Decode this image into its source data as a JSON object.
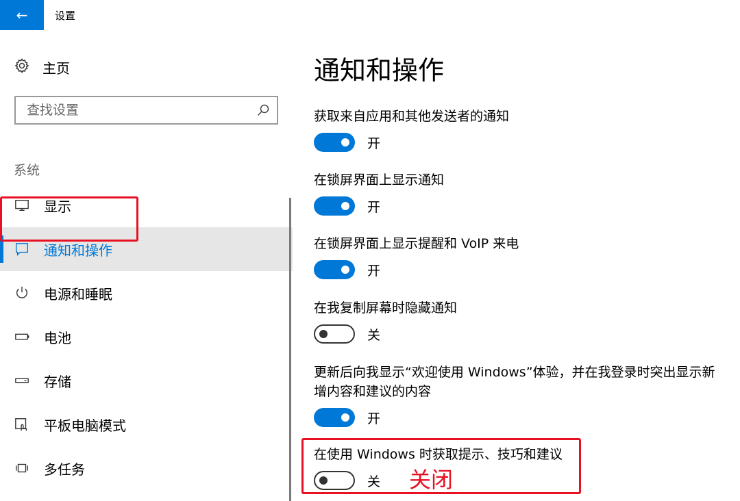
{
  "window": {
    "title": "设置",
    "back_icon": "back-arrow-icon"
  },
  "sidebar": {
    "home_label": "主页",
    "search_placeholder": "查找设置",
    "group_label": "系统",
    "items": [
      {
        "label": "显示",
        "icon": "monitor-icon"
      },
      {
        "label": "通知和操作",
        "icon": "message-icon",
        "selected": true
      },
      {
        "label": "电源和睡眠",
        "icon": "power-icon"
      },
      {
        "label": "电池",
        "icon": "battery-icon"
      },
      {
        "label": "存储",
        "icon": "storage-icon"
      },
      {
        "label": "平板电脑模式",
        "icon": "tablet-mode-icon"
      },
      {
        "label": "多任务",
        "icon": "multitask-icon"
      }
    ]
  },
  "main": {
    "title": "通知和操作",
    "settings": [
      {
        "label": "获取来自应用和其他发送者的通知",
        "state": "开",
        "on": true
      },
      {
        "label": "在锁屏界面上显示通知",
        "state": "开",
        "on": true
      },
      {
        "label": "在锁屏界面上显示提醒和 VoIP 来电",
        "state": "开",
        "on": true
      },
      {
        "label": "在我复制屏幕时隐藏通知",
        "state": "关",
        "on": false
      },
      {
        "label": "更新后向我显示“欢迎使用 Windows”体验，并在我登录时突出显示新增内容和建议的内容",
        "state": "开",
        "on": true
      },
      {
        "label": "在使用 Windows 时获取提示、技巧和建议",
        "state": "关",
        "on": false
      }
    ]
  },
  "annotation": {
    "text": "关闭",
    "color": "#e81123"
  },
  "colors": {
    "accent": "#0078d7",
    "highlight": "#e81123"
  }
}
